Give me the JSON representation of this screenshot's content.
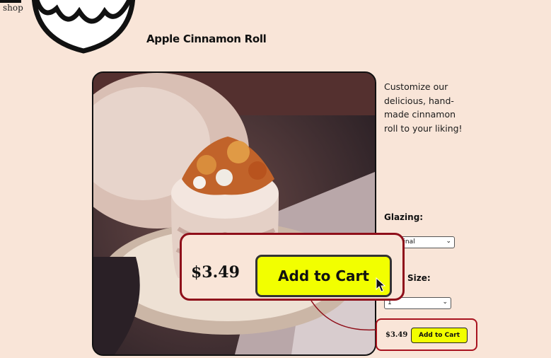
{
  "logo": {
    "text": "shop"
  },
  "product": {
    "title": "Apple Cinnamon Roll"
  },
  "description": "Customize our delicious, hand-made cinnamon roll to your liking!",
  "glazing": {
    "label": "Glazing:",
    "selected": "Keep original",
    "visible_value": "original"
  },
  "pack_size": {
    "label": "Size:",
    "selected": "1"
  },
  "cart": {
    "price": "$3.49",
    "button_label": "Add to Cart"
  },
  "zoom": {
    "price": "$3.49",
    "button_label": "Add to Cart"
  },
  "colors": {
    "background": "#f9e5d8",
    "accent_yellow": "#f2ff00",
    "highlight_red": "#8f0f1a"
  }
}
